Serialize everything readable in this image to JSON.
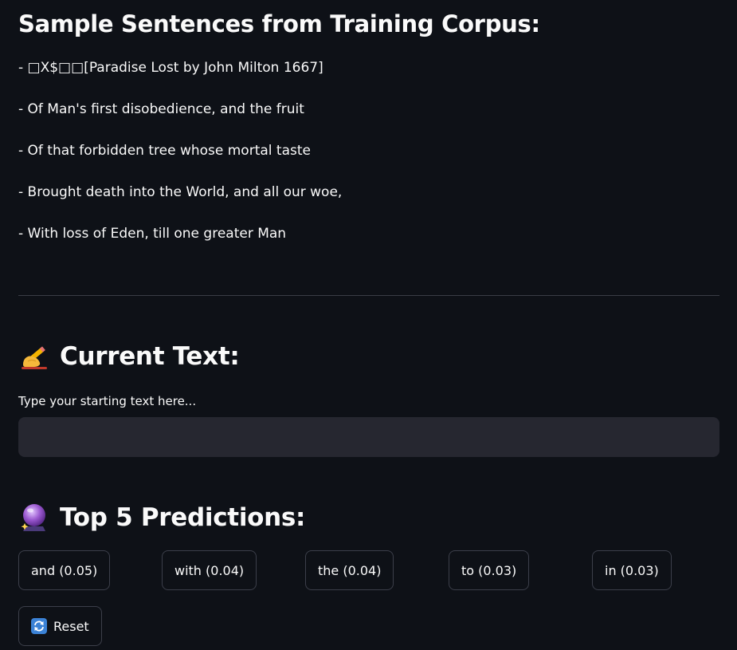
{
  "sample": {
    "heading": "Sample Sentences from Training Corpus:",
    "sentences": [
      "- □X$□□[Paradise Lost by John Milton 1667]",
      "- Of Man's first disobedience, and the fruit",
      "- Of that forbidden tree whose mortal taste",
      "- Brought death into the World, and all our woe,",
      "- With loss of Eden, till one greater Man"
    ]
  },
  "current": {
    "heading": "Current Text:",
    "icon": "writing-hand-icon",
    "input_label": "Type your starting text here...",
    "input_value": ""
  },
  "predictions": {
    "heading": "Top 5 Predictions:",
    "icon": "crystal-ball-icon",
    "items": [
      "and (0.05)",
      "with (0.04)",
      "the (0.04)",
      "to (0.03)",
      "in (0.03)"
    ]
  },
  "reset": {
    "label": "Reset",
    "icon": "refresh-icon"
  },
  "colors": {
    "background": "#0e1117",
    "text": "#fafafa",
    "input_bg": "#262730",
    "button_border": "#3c3f4a",
    "reset_icon_bg": "#3b82d6"
  }
}
